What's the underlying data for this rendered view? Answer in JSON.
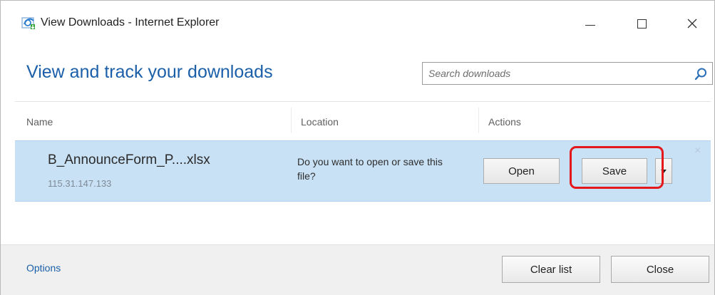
{
  "window": {
    "title": "View Downloads - Internet Explorer",
    "controls": {
      "minimize": "—",
      "maximize": "",
      "close": "×"
    }
  },
  "header": {
    "title": "View and track your downloads",
    "search": {
      "placeholder": "Search downloads",
      "value": ""
    }
  },
  "columns": {
    "name": "Name",
    "location": "Location",
    "actions": "Actions"
  },
  "downloads": [
    {
      "file_name": "B_AnnounceForm_P....xlsx",
      "source": "115.31.147.133",
      "prompt": "Do you want to open or save this file?",
      "open_label": "Open",
      "save_label": "Save",
      "remove_label": "×"
    }
  ],
  "footer": {
    "options_label": "Options",
    "clear_list_label": "Clear list",
    "close_label": "Close"
  },
  "colors": {
    "accent": "#1a5fa8",
    "row_highlight": "#c9e1f5",
    "annotation": "#e4171b"
  },
  "icons": {
    "app": "ie-downloads-icon",
    "search": "search-icon",
    "dropdown": "chevron-down-icon"
  }
}
